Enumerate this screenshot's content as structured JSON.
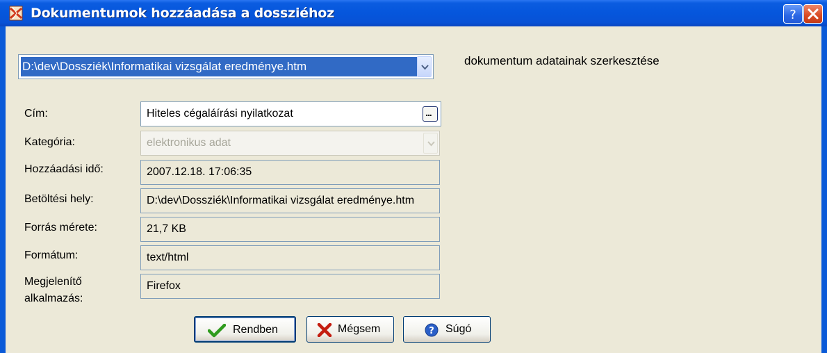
{
  "window": {
    "title": "Dokumentumok hozzáadása a dossziéhoz",
    "help_glyph": "?"
  },
  "document_select": {
    "selected": "D:\\dev\\Dossziék\\Informatikai vizsgálat eredménye.htm",
    "side_label": "dokumentum adatainak szerkesztése"
  },
  "form": {
    "cim": {
      "label": "Cím:",
      "value": "Hiteles cégaláírási nyilatkozat",
      "button": "..."
    },
    "kategoria": {
      "label": "Kategória:",
      "value": "elektronikus adat"
    },
    "hozzaadasi_ido": {
      "label": "Hozzáadási idő:",
      "value": "2007.12.18. 17:06:35"
    },
    "betoltesi_hely": {
      "label": "Betöltési hely:",
      "value": "D:\\dev\\Dossziék\\Informatikai vizsgálat eredménye.htm"
    },
    "forras_merete": {
      "label": "Forrás mérete:",
      "value": "21,7 KB"
    },
    "formatum": {
      "label": "Formátum:",
      "value": "text/html"
    },
    "megjelenito": {
      "label_line1": "Megjelenítő",
      "label_line2": "alkalmazás:",
      "value": "Firefox"
    }
  },
  "buttons": {
    "ok": "Rendben",
    "cancel": "Mégsem",
    "help": "Súgó"
  },
  "colors": {
    "titlebar": "#0556dc",
    "client_bg": "#ece9d8",
    "selection": "#316ac5",
    "ok_check": "#2f9b1e",
    "cancel_x": "#c41d10",
    "help_icon": "#2a5fc8"
  },
  "icons": {
    "app": "document-dossier-icon",
    "ok": "checkmark-icon",
    "cancel": "red-x-icon",
    "help": "help-question-icon"
  }
}
